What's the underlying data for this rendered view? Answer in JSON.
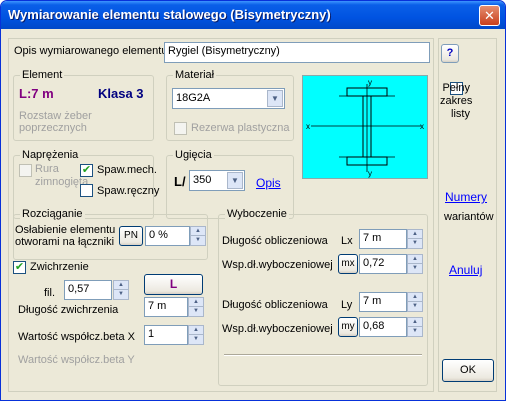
{
  "window": {
    "title": "Wymiarowanie elementu stalowego (Bisymetryczny)",
    "close_label": "✕"
  },
  "opis": {
    "label": "Opis wymiarowanego elementu",
    "value": "Rygiel (Bisymetryczny)"
  },
  "element": {
    "group_title": "Element",
    "length": "L:7 m",
    "klasa": "Klasa 3",
    "rozstaw_label": "Rozstaw żeber poprzecznych"
  },
  "material": {
    "group_title": "Materiał",
    "selected": "18G2A",
    "rezerwa_label": "Rezerwa plastyczna",
    "rezerwa_checked": false
  },
  "section_diagram": {
    "background": "#00ffff",
    "axis_labels": [
      "x",
      "x",
      "y",
      "y"
    ]
  },
  "sidebar": {
    "help_label": "?",
    "pelny_label": "Pełny zakres listy",
    "pelny_checked": false,
    "numery_label": "Numery",
    "wariantow_label": "wariantów",
    "anuluj_label": "Anuluj",
    "ok_label": "OK"
  },
  "naprezenia": {
    "group_title": "Naprężenia",
    "rura_label": "Rura zimnogięta",
    "rura_checked": false,
    "spaw_mech_label": "Spaw.mech.",
    "spaw_mech_checked": true,
    "spaw_reczny_label": "Spaw.ręczny",
    "spaw_reczny_checked": false
  },
  "ugiecia": {
    "group_title": "Ugięcia",
    "prefix": "L/",
    "selected": "350",
    "opis_link": "Opis"
  },
  "rozciaganie": {
    "group_title": "Rozciąganie",
    "oslabienie_label": "Osłabienie elementu otworami na łączniki",
    "pn_button": "PN",
    "value": "0 %"
  },
  "zwichrzenie": {
    "checkbox_label": "Zwichrzenie",
    "checked": true,
    "fil_label": "fil.",
    "fil_value": "0,57",
    "l_button": "L",
    "dlugosc_label": "Długość zwichrzenia",
    "dlugosc_value": "7 m",
    "beta_x_label": "Wartość współcz.beta X",
    "beta_x_value": "1",
    "beta_y_label": "Wartość współcz.beta Y"
  },
  "wyboczenie": {
    "group_title": "Wyboczenie",
    "dlugosc_x_label": "Długość obliczeniowa",
    "lx_label": "Lx",
    "lx_value": "7 m",
    "wsp_x_label": "Wsp.dł.wyboczeniowej",
    "mx_button": "mx",
    "mx_value": "0,72",
    "dlugosc_y_label": "Długość obliczeniowa",
    "ly_label": "Ly",
    "ly_value": "7 m",
    "wsp_y_label": "Wsp.dł.wyboczeniowej",
    "my_button": "my",
    "my_value": "0,68"
  }
}
